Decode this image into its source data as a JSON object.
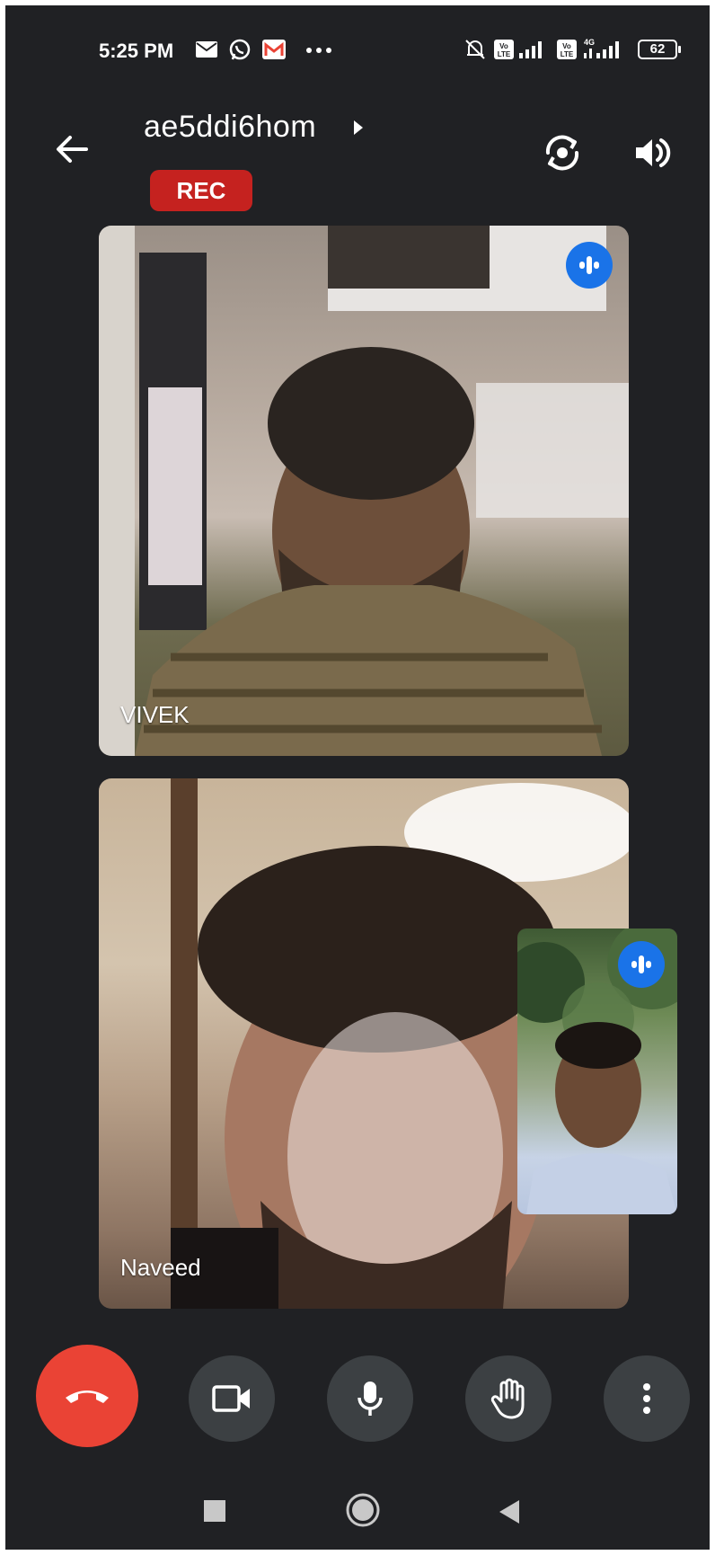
{
  "status_bar": {
    "time": "5:25 PM",
    "notification_icons": [
      "mail-icon",
      "whatsapp-icon",
      "gmail-icon",
      "more-dots-icon"
    ],
    "system_icons": [
      "mute-bell-icon",
      "volte-icon",
      "signal-icon",
      "volte-icon",
      "4g-signal-icon"
    ],
    "battery": "62"
  },
  "header": {
    "meeting_code": "ae5ddi6hom",
    "rec_label": "REC",
    "rec_color": "#c5221f"
  },
  "participants": [
    {
      "name": "VIVEK",
      "speaking_indicator": true
    },
    {
      "name": "Naveed",
      "speaking_indicator": false
    }
  ],
  "self_view": {
    "speaking_indicator": true
  },
  "controls": {
    "end_call_color": "#ea4335",
    "buttons": [
      "end-call",
      "camera",
      "microphone",
      "raise-hand",
      "more-options"
    ]
  },
  "colors": {
    "background": "#202124",
    "control_bg": "#3c4043",
    "accent": "#1a73e8"
  }
}
